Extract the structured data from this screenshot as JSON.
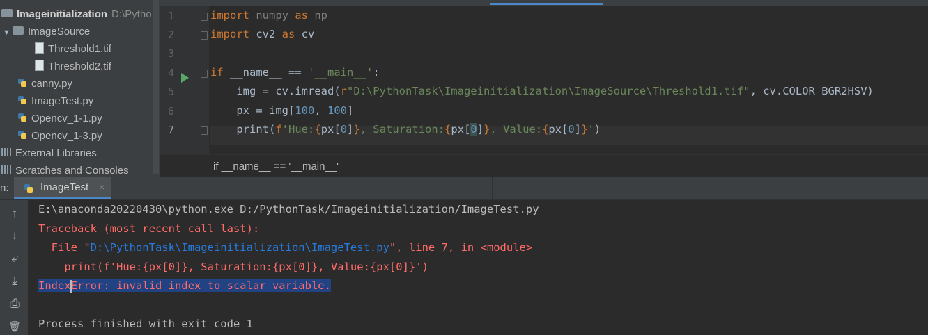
{
  "project_tree": {
    "root": {
      "name": "Imageinitialization",
      "path": "D:\\Pytho"
    },
    "folder": {
      "name": "ImageSource"
    },
    "folder_files": [
      "Threshold1.tif",
      "Threshold2.tif"
    ],
    "files": [
      "canny.py",
      "ImageTest.py",
      "Opencv_1-1.py",
      "Opencv_1-3.py"
    ],
    "external_libraries": "External Libraries",
    "scratches": "Scratches and Consoles"
  },
  "editor": {
    "line_numbers": [
      "1",
      "2",
      "3",
      "4",
      "5",
      "6",
      "7"
    ],
    "code": {
      "l1": [
        "import",
        " numpy ",
        "as",
        " np"
      ],
      "l2": [
        "import",
        " cv2 ",
        "as",
        " cv"
      ],
      "l4": [
        "if",
        " __name__ == ",
        "'__main__'",
        ":"
      ],
      "l5": [
        "    img = cv.imread(",
        "r",
        "\"D:\\PythonTask\\Imageinitialization\\ImageSource\\Threshold1.tif\"",
        ", cv.COLOR_BGR2HSV)"
      ],
      "l6": [
        "    px = img[",
        "100",
        ", ",
        "100",
        "]"
      ],
      "l7": [
        "    print(",
        "f",
        "'Hue:",
        "{",
        "px[",
        "0",
        "]",
        "}",
        ", Saturation:",
        "{",
        "px[",
        "0",
        "]",
        "}",
        ", Value:",
        "{",
        "px[",
        "0",
        "]",
        "}",
        "'",
        ")"
      ]
    },
    "breadcrumb": "if __name__ == '__main__'"
  },
  "run_panel": {
    "label": "n:",
    "tab_label": "ImageTest",
    "close_glyph": "×",
    "console": {
      "command": "E:\\anaconda20220430\\python.exe D:/PythonTask/Imageinitialization/ImageTest.py",
      "traceback": "Traceback (most recent call last):",
      "file_prefix": "  File \"",
      "file_link": "D:\\PythonTask\\Imageinitialization\\ImageTest.py",
      "file_suffix": "\", line 7, in <module>",
      "code_line": "    print(f'Hue:{px[0]}, Saturation:{px[0]}, Value:{px[0]}')",
      "error_a": "Index",
      "error_b": "Error: invalid index to scalar variable.",
      "finished": "Process finished with exit code 1"
    },
    "tools": {
      "up": "↑",
      "down": "↓",
      "wrap": "⤶",
      "scroll_end": "⤓",
      "print": "⎙",
      "trash": "🗑"
    }
  },
  "colors": {
    "keyword": "#cc7832",
    "string": "#6a8759",
    "number": "#6897bb",
    "error": "#ff6b68",
    "link": "#287bde",
    "selection": "#214283"
  }
}
